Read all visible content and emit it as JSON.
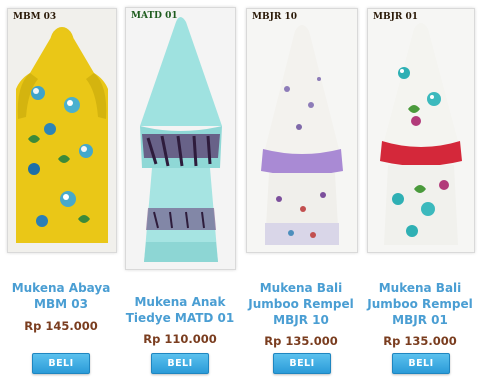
{
  "products": [
    {
      "code": "MBM 03",
      "name_line1": "Mukena Abaya",
      "name_line2": "MBM 03",
      "name_line3": "",
      "price": "Rp 145.000",
      "buy_label": "BELI",
      "code_color": "#2b1a08"
    },
    {
      "code": "MATD 01",
      "name_line1": "Mukena Anak",
      "name_line2": "Tiedye MATD 01",
      "name_line3": "",
      "price": "Rp 110.000",
      "buy_label": "BELI",
      "code_color": "#1e5c1e"
    },
    {
      "code": "MBJR 10",
      "name_line1": "Mukena Bali",
      "name_line2": "Jumboo Rempel",
      "name_line3": "MBJR 10",
      "price": "Rp 135.000",
      "buy_label": "BELI",
      "code_color": "#2b1a08"
    },
    {
      "code": "MBJR 01",
      "name_line1": "Mukena Bali",
      "name_line2": "Jumboo Rempel",
      "name_line3": "MBJR 01",
      "price": "Rp 135.000",
      "buy_label": "BELI",
      "code_color": "#2b1a08"
    }
  ],
  "colors": {
    "name": "#4a9ed3",
    "price": "#7a3d1f",
    "button": "#2b9bd8"
  }
}
